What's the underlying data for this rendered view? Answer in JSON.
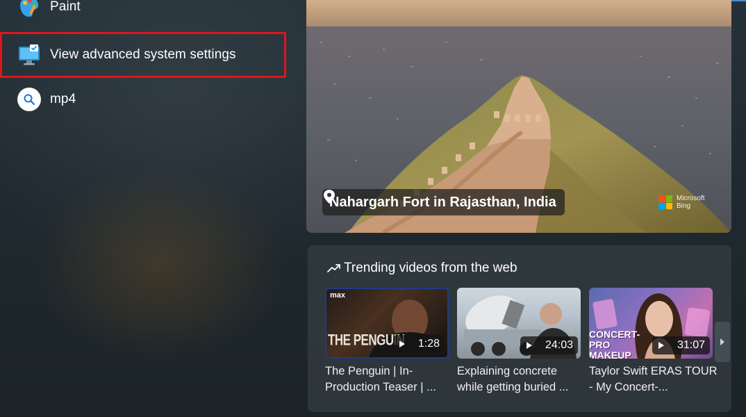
{
  "results": {
    "items": [
      {
        "label": "Paint",
        "icon": "paint-icon"
      },
      {
        "label": "View advanced system settings",
        "icon": "system-settings-icon"
      },
      {
        "label": "mp4",
        "icon": "search-icon"
      }
    ]
  },
  "hero": {
    "location": "Nahargarh Fort in Rajasthan, India",
    "brand_line1": "Microsoft",
    "brand_line2": "Bing"
  },
  "trending": {
    "title": "Trending videos from the web",
    "videos": [
      {
        "title": "The Penguin | In-Production Teaser | ...",
        "duration": "1:28",
        "thumb_text": "THE PENGUIN",
        "badge": "max"
      },
      {
        "title": "Explaining concrete while getting buried ...",
        "duration": "24:03"
      },
      {
        "title": "Taylor Swift ERAS TOUR - My Concert-...",
        "duration": "31:07",
        "thumb_text": "CONCERT-PRO MAKEUP"
      }
    ]
  },
  "colors": {
    "highlight": "#e0151b",
    "accent": "#4a8fd8"
  }
}
